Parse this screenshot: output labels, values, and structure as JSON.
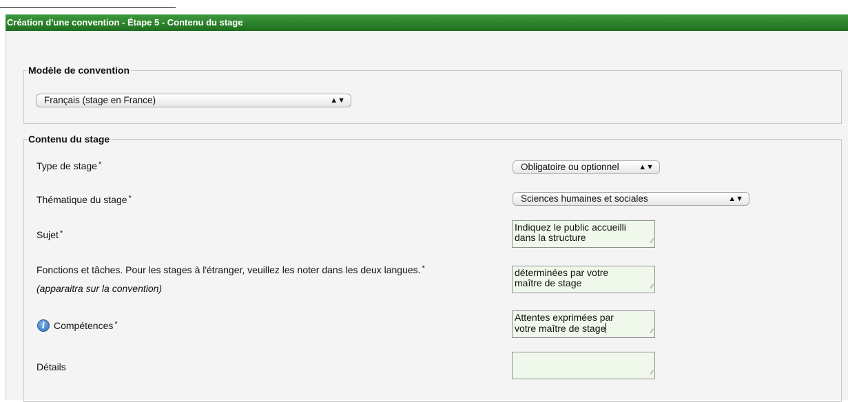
{
  "header": {
    "title": "Création d'une convention - Étape 5 - Contenu du stage"
  },
  "model_section": {
    "legend": "Modèle de convention",
    "select_value": "Français (stage en France)"
  },
  "content_section": {
    "legend": "Contenu du stage",
    "type_stage": {
      "label": "Type de stage",
      "required": "*",
      "value": "Obligatoire ou optionnel"
    },
    "thematique": {
      "label": "Thématique du stage",
      "required": "*",
      "value": "Sciences humaines et sociales"
    },
    "sujet": {
      "label": "Sujet",
      "required": "*",
      "value_line1": "Indiquez le public accueilli",
      "value_line2": "dans la structure"
    },
    "fonctions": {
      "label": "Fonctions et tâches. Pour les stages à l'étranger, veuillez les noter dans les deux langues.",
      "required": "*",
      "note": "(apparaitra sur la convention)",
      "value_line1": "déterminées par votre",
      "value_line2": "maître de stage"
    },
    "competences": {
      "label": "Compétences",
      "required": "*",
      "value_line1": "Attentes exprimées par",
      "value_line2": "votre maître de stage"
    },
    "details": {
      "label": "Détails",
      "value": ""
    }
  },
  "icons": {
    "select_arrows": "up-down-arrows-icon",
    "info": "info-icon",
    "resize": "resize-grip-icon"
  },
  "colors": {
    "header_green": "#2b7f2b",
    "field_bg": "#f0f8ec",
    "panel_bg": "#f4f4f4"
  }
}
